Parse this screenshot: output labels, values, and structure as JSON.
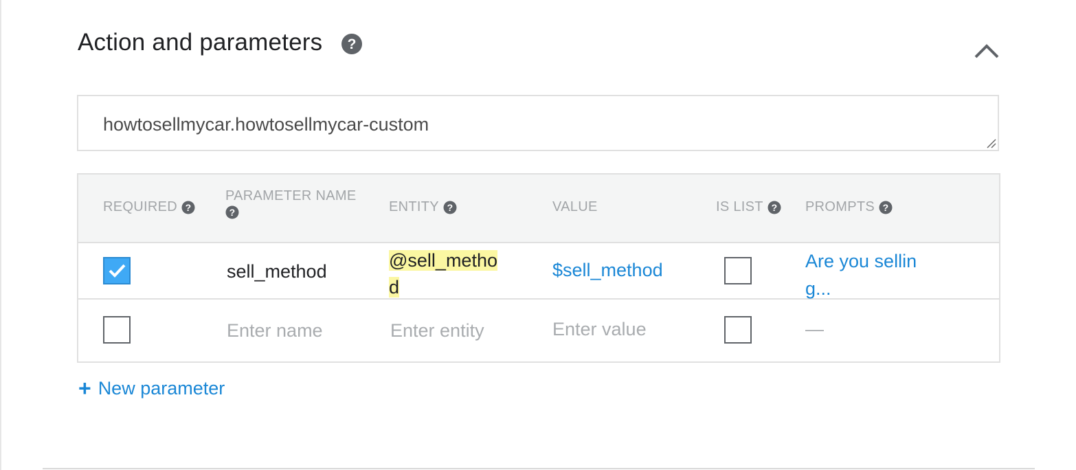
{
  "section": {
    "title": "Action and parameters"
  },
  "action": {
    "value": "howtosellmycar.howtosellmycar-custom"
  },
  "table": {
    "headers": {
      "required": "REQUIRED",
      "parameter_name": "PARAMETER NAME",
      "entity": "ENTITY",
      "value": "VALUE",
      "is_list": "IS LIST",
      "prompts": "PROMPTS"
    },
    "rows": [
      {
        "required": true,
        "name": "sell_method",
        "entity_line1": "@sell_metho",
        "entity_line2": "d",
        "value": "$sell_method",
        "is_list": false,
        "prompts_line1": "Are you sellin",
        "prompts_line2": "g..."
      },
      {
        "required": false,
        "name_placeholder": "Enter name",
        "entity_placeholder": "Enter entity",
        "value_placeholder": "Enter value",
        "is_list": false,
        "prompts": "—"
      }
    ]
  },
  "new_parameter": {
    "label": "New parameter"
  },
  "icons": {
    "help": "help-icon",
    "collapse": "chevron-up-icon",
    "add": "plus-icon",
    "check": "check-icon"
  },
  "colors": {
    "accent": "#1a87d6",
    "checkbox_checked": "#3fa9f5",
    "entity_highlight": "#fbf7a2",
    "header_bg": "#f4f5f5"
  }
}
